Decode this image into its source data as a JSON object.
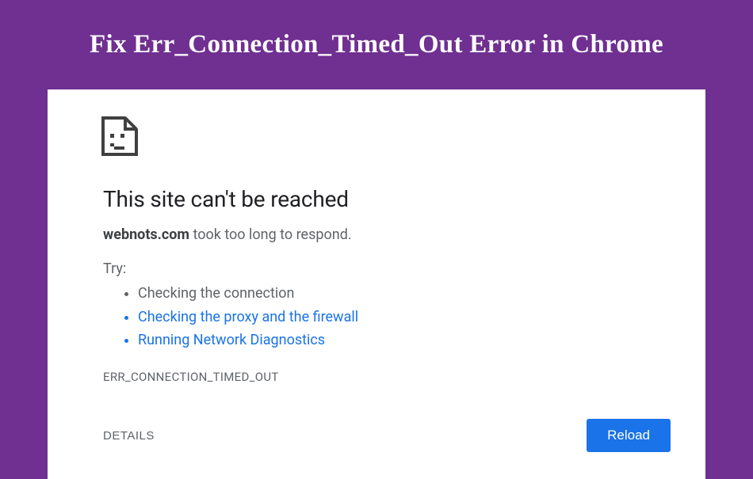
{
  "page": {
    "title": "Fix Err_Connection_Timed_Out Error in Chrome"
  },
  "error": {
    "icon": "sad-page-icon",
    "heading": "This site can't be reached",
    "hostname": "webnots.com",
    "message_suffix": " took too long to respond.",
    "try_label": "Try:",
    "suggestions": [
      {
        "text": "Checking the connection",
        "is_link": false
      },
      {
        "text": "Checking the proxy and the firewall",
        "is_link": true
      },
      {
        "text": "Running Network Diagnostics",
        "is_link": true
      }
    ],
    "code": "ERR_CONNECTION_TIMED_OUT",
    "details_label": "DETAILS",
    "reload_label": "Reload"
  }
}
